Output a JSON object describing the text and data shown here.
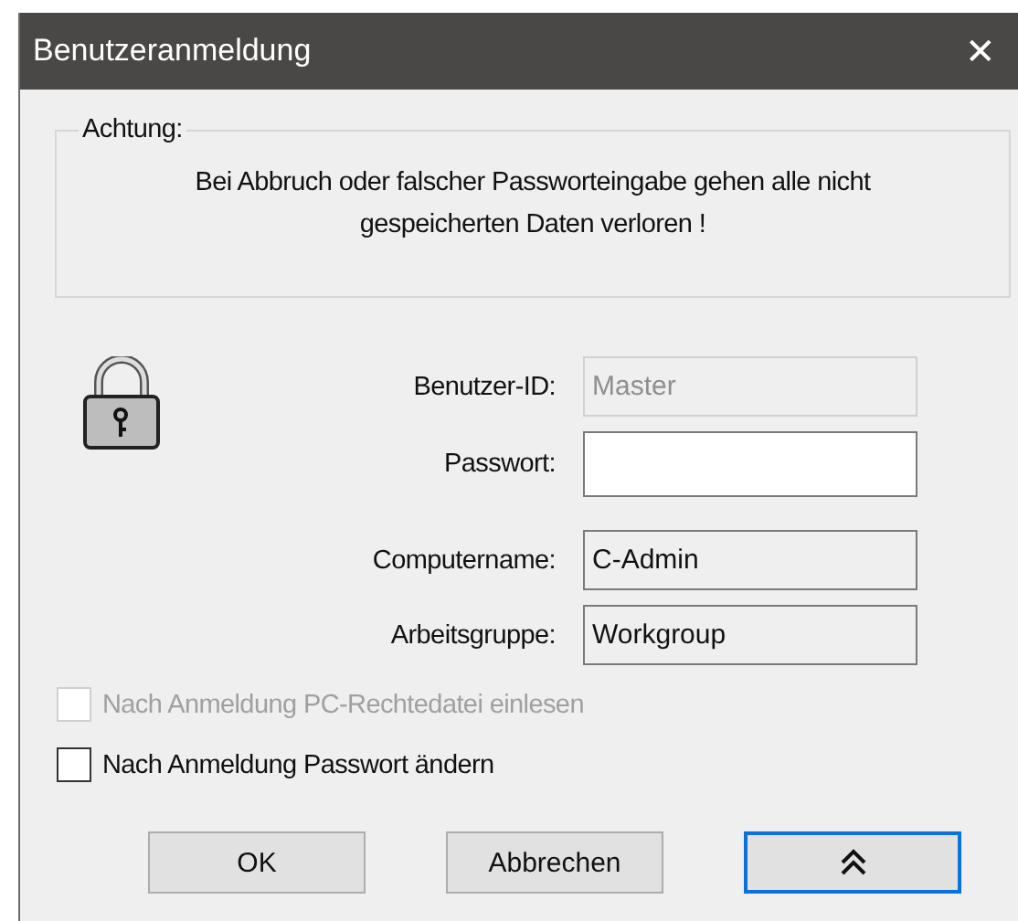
{
  "window": {
    "title": "Benutzeranmeldung",
    "close": "✕"
  },
  "notice": {
    "legend": "Achtung:",
    "text": "Bei Abbruch oder falscher Passworteingabe gehen alle nicht gespeicherten Daten verloren !"
  },
  "fields": [
    {
      "label": "Benutzer-ID:",
      "value": "Master",
      "kind": "disabled"
    },
    {
      "label": "Passwort:",
      "kind": "password"
    },
    {
      "label": "Computername:",
      "value": "C-Admin",
      "kind": "readonly"
    },
    {
      "label": "Arbeitsgruppe:",
      "value": "Workgroup",
      "kind": "readonly"
    }
  ],
  "checkboxes": [
    {
      "label": "Nach Anmeldung PC-Rechtedatei einlesen",
      "checked": false,
      "disabled": true
    },
    {
      "label": "Nach Anmeldung Passwort ändern",
      "checked": false,
      "disabled": false
    }
  ],
  "buttons": [
    {
      "kind": "text",
      "label": "OK",
      "focused": false
    },
    {
      "kind": "text",
      "label": "Abbrechen",
      "focused": false
    },
    {
      "kind": "collapse",
      "focused": true
    }
  ]
}
